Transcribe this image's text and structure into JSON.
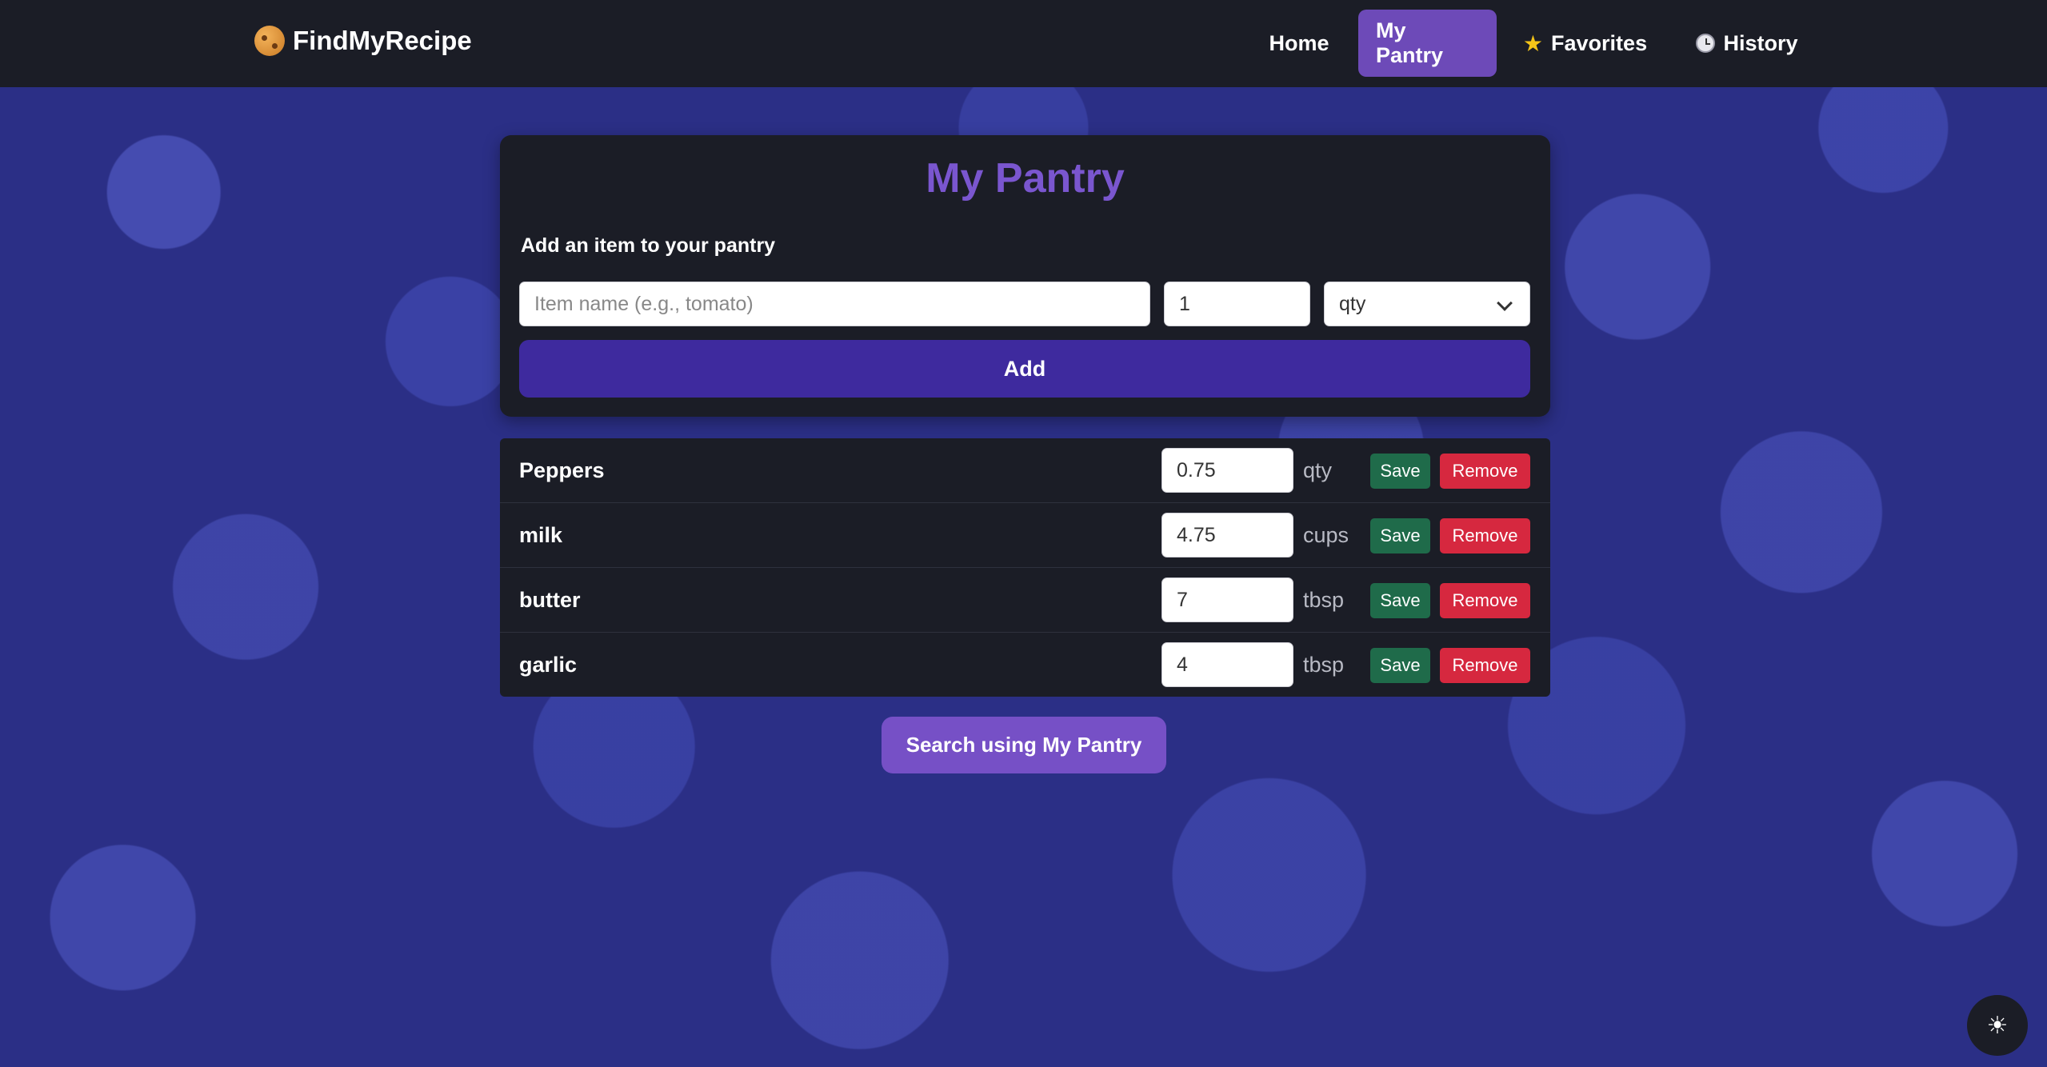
{
  "app": {
    "brand_name": "FindMyRecipe",
    "brand_icon": "cookie-icon"
  },
  "nav": {
    "items": [
      {
        "label": "Home",
        "active": false
      },
      {
        "label": "My Pantry",
        "active": true
      },
      {
        "label": "Favorites",
        "icon": "star-icon",
        "active": false
      },
      {
        "label": "History",
        "icon": "clock-icon",
        "active": false
      }
    ]
  },
  "pantry": {
    "title": "My Pantry",
    "add_label": "Add an item to your pantry",
    "item_placeholder": "Item name (e.g., tomato)",
    "qty_value": "1",
    "unit_selected": "qty",
    "add_button": "Add",
    "items": [
      {
        "name": "Peppers",
        "qty": "0.75",
        "unit": "qty"
      },
      {
        "name": "milk",
        "qty": "4.75",
        "unit": "cups"
      },
      {
        "name": "butter",
        "qty": "7",
        "unit": "tbsp"
      },
      {
        "name": "garlic",
        "qty": "4",
        "unit": "tbsp"
      }
    ],
    "save_label": "Save",
    "remove_label": "Remove",
    "search_button": "Search using My Pantry"
  },
  "theme_toggle_icon": "sun-icon",
  "colors": {
    "accent": "#7650c6",
    "add_button": "#3e2a9e",
    "save": "#1f6b4a",
    "remove": "#d6283f",
    "panel": "#1b1d26"
  }
}
